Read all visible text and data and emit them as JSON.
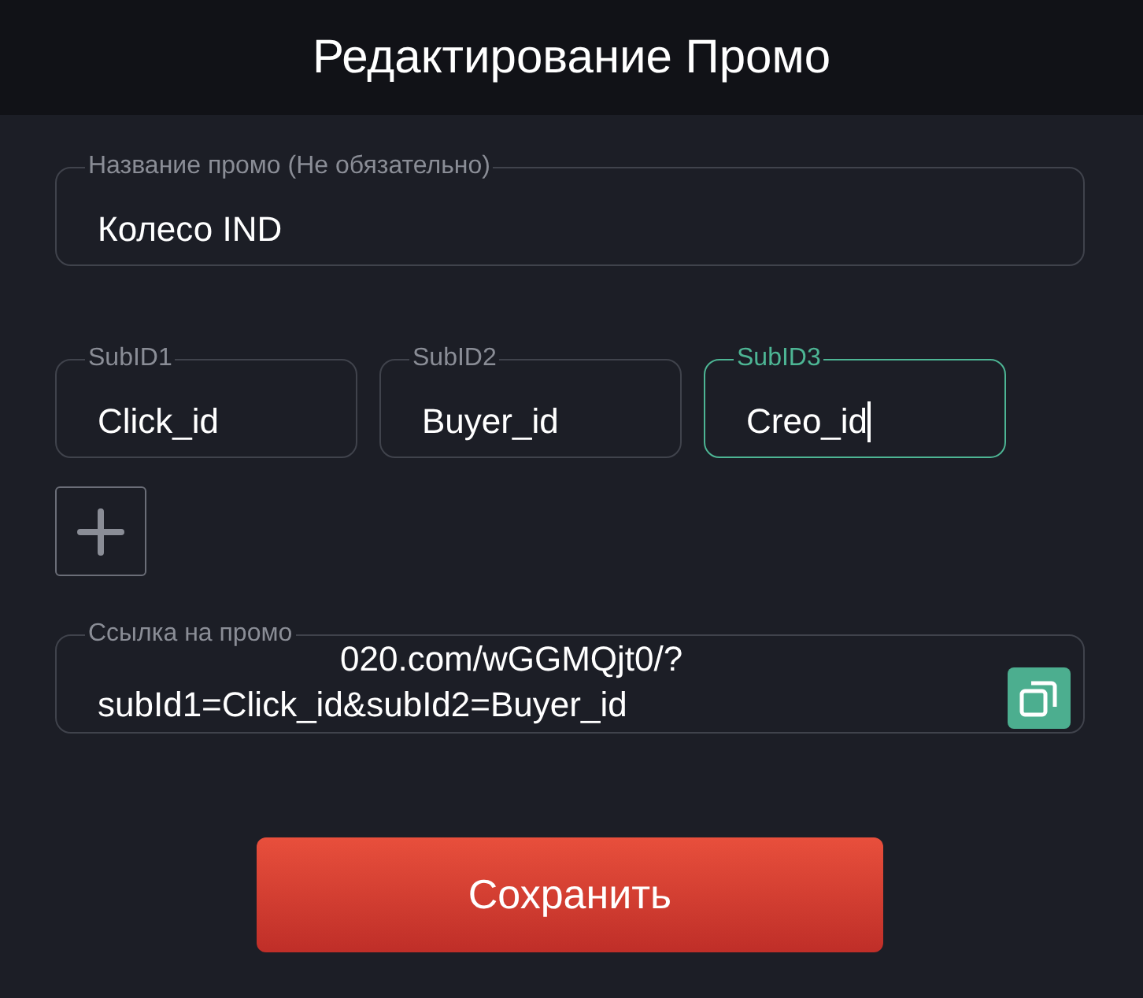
{
  "title": "Редактирование Промо",
  "name_field": {
    "label": "Название промо (Не обязательно)",
    "value": "Колесо IND",
    "focused": false
  },
  "subids": [
    {
      "label": "SubID1",
      "value": "Click_id",
      "focused": false
    },
    {
      "label": "SubID2",
      "value": "Buyer_id",
      "focused": false
    },
    {
      "label": "SubID3",
      "value": "Creo_id",
      "focused": true
    }
  ],
  "link_field": {
    "label": "Ссылка на промо",
    "line_1": "020.com/wGGMQjt0/?",
    "line_2": "subId1=Click_id&subId2=Buyer_id"
  },
  "save_button": "Сохранить"
}
